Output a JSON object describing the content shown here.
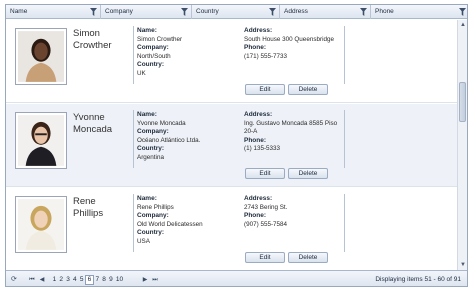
{
  "columns": [
    {
      "label": "Name"
    },
    {
      "label": "Company"
    },
    {
      "label": "Country"
    },
    {
      "label": "Address"
    },
    {
      "label": "Phone"
    }
  ],
  "labels": {
    "name": "Name:",
    "company": "Company:",
    "country": "Country:",
    "address": "Address:",
    "phone": "Phone:",
    "edit": "Edit",
    "delete": "Delete"
  },
  "rows": [
    {
      "first": "Simon",
      "last": "Crowther",
      "name": "Simon Crowther",
      "company": "North/South",
      "country": "UK",
      "address": "South House 300 Queensbridge",
      "phone": "(171) 555-7733",
      "photo_shirt": "#c8a078",
      "photo_hair": "#2a1a12",
      "photo_skin": "#6b4430"
    },
    {
      "first": "Yvonne",
      "last": "Moncada",
      "name": "Yvonne Moncada",
      "company": "Océano Atlántico Ltda.",
      "country": "Argentina",
      "address": "Ing. Gustavo Moncada 8585 Piso 20-A",
      "phone": "(1) 135-5333",
      "photo_shirt": "#1e1e24",
      "photo_hair": "#3a2418",
      "photo_skin": "#e8c4a8"
    },
    {
      "first": "Rene",
      "last": "Phillips",
      "name": "Rene Phillips",
      "company": "Old World Delicatessen",
      "country": "USA",
      "address": "2743 Bering St.",
      "phone": "(907) 555-7584",
      "photo_shirt": "#f1ece2",
      "photo_hair": "#c9a65e",
      "photo_skin": "#f0d2b8"
    }
  ],
  "pager": {
    "pages": [
      "1",
      "2",
      "3",
      "4",
      "5",
      "6",
      "7",
      "8",
      "9",
      "10"
    ],
    "current": "6",
    "info": "Displaying items 51 - 60 of 91"
  }
}
